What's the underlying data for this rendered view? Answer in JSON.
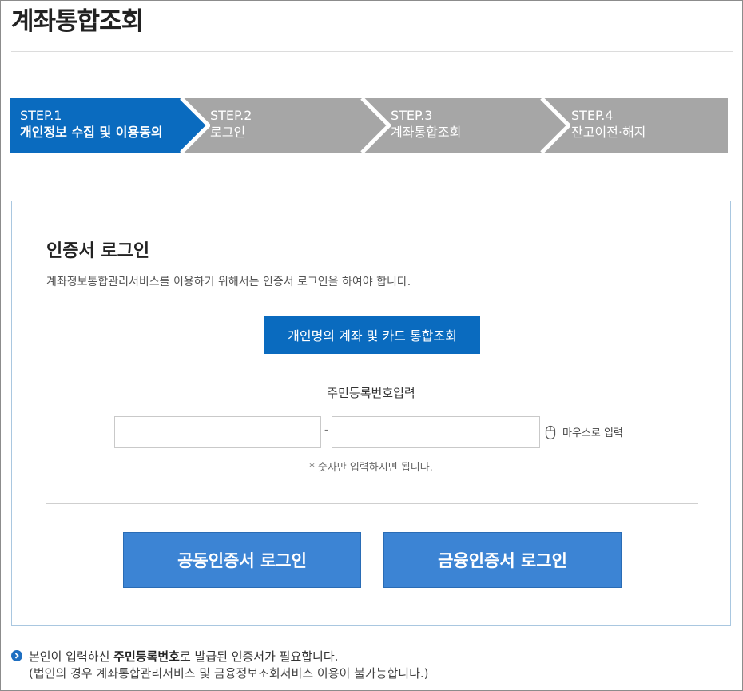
{
  "page": {
    "title": "계좌통합조회"
  },
  "steps": [
    {
      "num": "STEP.1",
      "label": "개인정보 수집 및 이용동의",
      "active": true
    },
    {
      "num": "STEP.2",
      "label": "로그인",
      "active": false
    },
    {
      "num": "STEP.3",
      "label": "계좌통합조회",
      "active": false
    },
    {
      "num": "STEP.4",
      "label": "잔고이전·해지",
      "active": false
    }
  ],
  "login": {
    "title": "인증서 로그인",
    "description": "계좌정보통합관리서비스를 이용하기 위해서는 인증서 로그인을 하여야 합니다.",
    "personal_button": "개인명의 계좌 및 카드 통합조회",
    "rrn_label": "주민등록번호입력",
    "rrn_front_value": "",
    "rrn_back_value": "",
    "rrn_separator": "-",
    "mouse_input_label": "마우스로 입력",
    "rrn_note": "* 숫자만 입력하시면 됩니다.",
    "joint_cert_button": "공동인증서 로그인",
    "financial_cert_button": "금융인증서 로그인"
  },
  "notice": {
    "line1_prefix": "본인이 입력하신 ",
    "line1_bold": "주민등록번호",
    "line1_suffix": "로 발급된 인증서가 필요합니다.",
    "line2": "(법인의 경우 계좌통합관리서비스 및 금융정보조회서비스 이용이 불가능합니다.)"
  },
  "colors": {
    "accent": "#0a6bbf",
    "step_inactive": "#a6a6a6",
    "cert_button": "#3c84d4",
    "box_border": "#a9c7e0"
  },
  "icons": {
    "step_separator": "chevron-right-icon",
    "mouse": "mouse-icon",
    "notice": "chevron-circle-icon"
  }
}
